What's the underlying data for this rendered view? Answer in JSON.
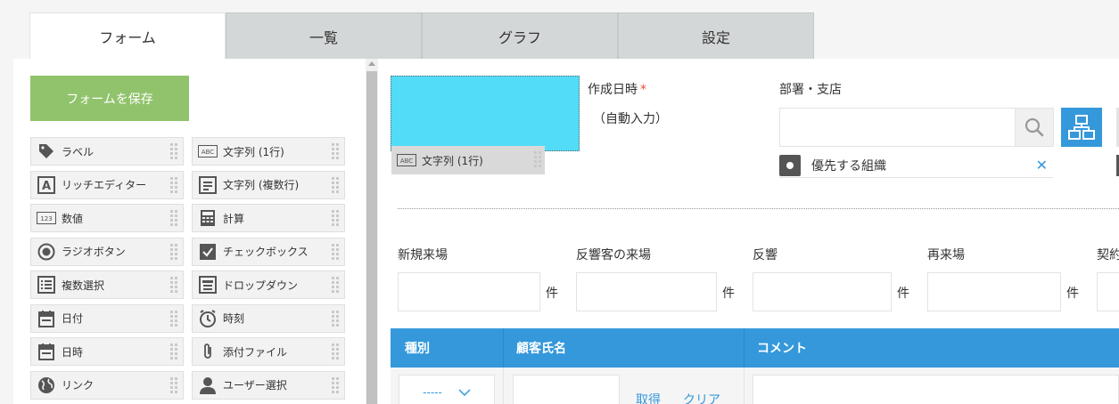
{
  "tabs": [
    {
      "label": "フォーム",
      "active": true
    },
    {
      "label": "一覧",
      "active": false
    },
    {
      "label": "グラフ",
      "active": false
    },
    {
      "label": "設定",
      "active": false
    }
  ],
  "palette": {
    "save_label": "フォームを保存",
    "items": [
      {
        "label": "ラベル",
        "icon": "tag-icon"
      },
      {
        "label": "文字列 (1行)",
        "icon": "abc-icon"
      },
      {
        "label": "リッチエディター",
        "icon": "rich-text-icon"
      },
      {
        "label": "文字列 (複数行)",
        "icon": "multiline-text-icon"
      },
      {
        "label": "数値",
        "icon": "number-icon"
      },
      {
        "label": "計算",
        "icon": "calculator-icon"
      },
      {
        "label": "ラジオボタン",
        "icon": "radio-icon"
      },
      {
        "label": "チェックボックス",
        "icon": "checkbox-icon"
      },
      {
        "label": "複数選択",
        "icon": "multi-select-icon"
      },
      {
        "label": "ドロップダウン",
        "icon": "dropdown-icon"
      },
      {
        "label": "日付",
        "icon": "calendar-icon"
      },
      {
        "label": "時刻",
        "icon": "clock-icon"
      },
      {
        "label": "日時",
        "icon": "calendar-icon"
      },
      {
        "label": "添付ファイル",
        "icon": "paperclip-icon"
      },
      {
        "label": "リンク",
        "icon": "globe-icon"
      },
      {
        "label": "ユーザー選択",
        "icon": "user-icon"
      }
    ]
  },
  "form": {
    "drag_tag_label": "文字列 (1行)",
    "created_label": "作成日時",
    "required_mark": "*",
    "created_value": "（自動入力）",
    "org_label": "部署・支店",
    "org_preferred": "優先する組織",
    "num_fields": [
      {
        "label": "新規来場",
        "unit": "件"
      },
      {
        "label": "反響客の来場",
        "unit": "件"
      },
      {
        "label": "反響",
        "unit": "件"
      },
      {
        "label": "再来場",
        "unit": "件"
      },
      {
        "label": "契約",
        "unit": ""
      }
    ],
    "table": {
      "headers": [
        "種別",
        "顧客氏名",
        "コメント"
      ],
      "select_value": "-----",
      "get_label": "取得",
      "clear_label": "クリア"
    }
  },
  "colors": {
    "accent": "#3498db",
    "save_green": "#91c36c",
    "drop_cyan": "#52dcf8"
  }
}
